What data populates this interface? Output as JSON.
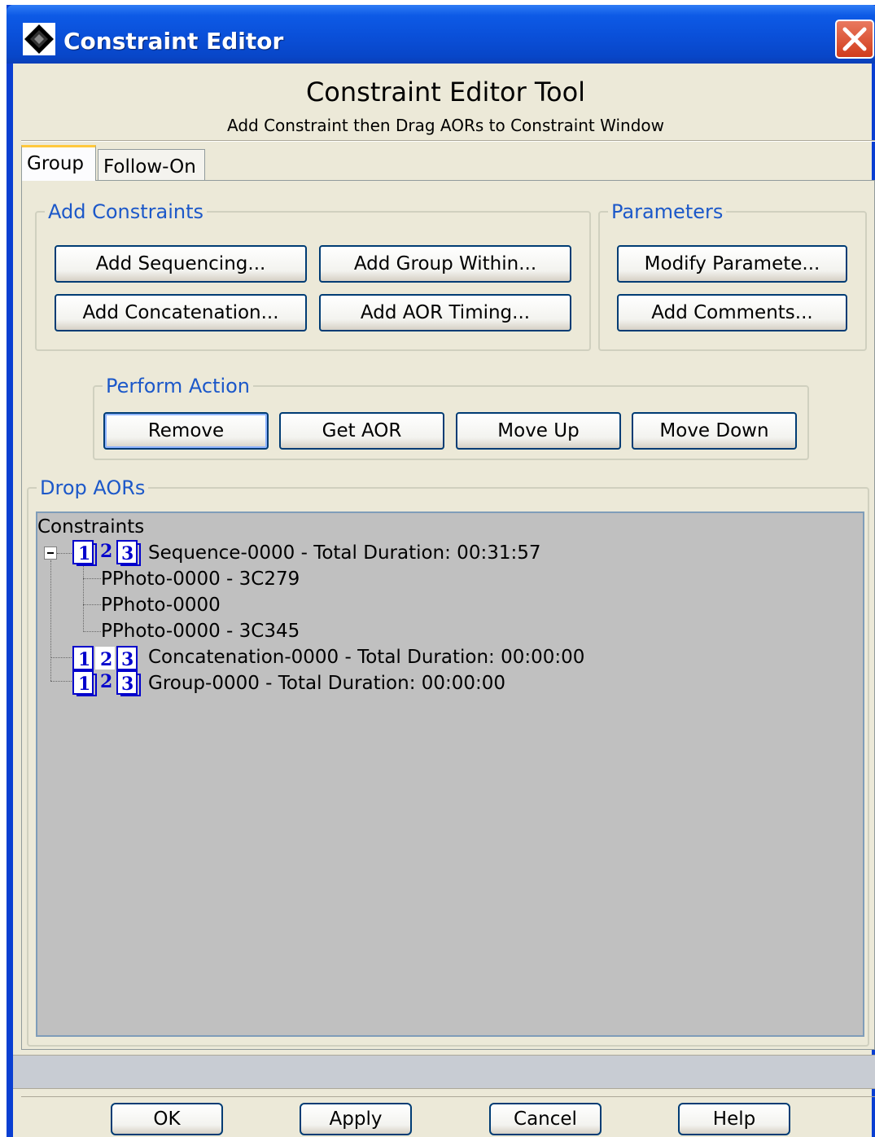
{
  "window": {
    "title": "Constraint Editor",
    "close_icon": "close-icon",
    "app_icon": "diamond-app-icon"
  },
  "header": {
    "title": "Constraint Editor Tool",
    "subtitle": "Add Constraint then Drag AORs to Constraint Window"
  },
  "tabs": [
    {
      "label": "Group",
      "selected": true
    },
    {
      "label": "Follow-On",
      "selected": false
    }
  ],
  "add_constraints": {
    "legend": "Add Constraints",
    "buttons": [
      "Add Sequencing...",
      "Add Group Within...",
      "Add Concatenation...",
      "Add AOR Timing..."
    ]
  },
  "parameters": {
    "legend": "Parameters",
    "buttons": [
      "Modify Paramete...",
      "Add Comments..."
    ]
  },
  "perform_action": {
    "legend": "Perform Action",
    "buttons": [
      "Remove",
      "Get AOR",
      "Move Up",
      "Move Down"
    ]
  },
  "drop_aors": {
    "legend": "Drop AORs",
    "tree": {
      "root": "Constraints",
      "nodes": [
        {
          "icon": "sequence-icon",
          "label": "Sequence-0000 - Total Duration: 00:31:57",
          "expanded": true,
          "children": [
            "PPhoto-0000 - 3C279",
            "PPhoto-0000",
            "PPhoto-0000 - 3C345"
          ]
        },
        {
          "icon": "concatenation-icon",
          "label": "Concatenation-0000 - Total Duration: 00:00:00",
          "children": []
        },
        {
          "icon": "group-icon",
          "label": "Group-0000 - Total Duration: 00:00:00",
          "children": []
        }
      ]
    }
  },
  "status_text": "",
  "footer": {
    "ok": "OK",
    "apply": "Apply",
    "cancel": "Cancel",
    "help": "Help"
  },
  "colors": {
    "title_bar": "#0a4fd8",
    "dialog_bg": "#ece9d8",
    "legend_text": "#1c58c9",
    "tree_bg": "#c0c0c0",
    "icon_blue": "#0000cc"
  }
}
